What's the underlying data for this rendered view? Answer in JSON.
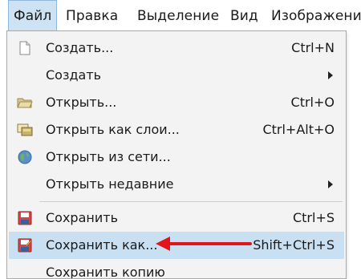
{
  "menubar": {
    "items": [
      {
        "label": "Файл"
      },
      {
        "label": "Правка"
      },
      {
        "label": "Выделение"
      },
      {
        "label": "Вид"
      },
      {
        "label": "Изображени"
      }
    ]
  },
  "file_menu": {
    "items": [
      {
        "label": "Создать...",
        "shortcut": "Ctrl+N",
        "icon": "new-document-icon"
      },
      {
        "label": "Создать",
        "shortcut": "",
        "icon": "",
        "submenu": true
      },
      {
        "label": "Открыть...",
        "shortcut": "Ctrl+O",
        "icon": "open-folder-icon"
      },
      {
        "label": "Открыть как слои...",
        "shortcut": "Ctrl+Alt+O",
        "icon": "open-as-layers-icon"
      },
      {
        "label": "Открыть из сети...",
        "shortcut": "",
        "icon": "globe-icon"
      },
      {
        "label": "Открыть недавние",
        "shortcut": "",
        "icon": "",
        "submenu": true
      },
      {
        "label": "Сохранить",
        "shortcut": "Ctrl+S",
        "icon": "save-icon"
      },
      {
        "label": "Сохранить как...",
        "shortcut": "Shift+Ctrl+S",
        "icon": "save-as-icon",
        "highlighted": true
      },
      {
        "label": "Сохранить копию",
        "shortcut": "",
        "icon": ""
      }
    ]
  },
  "colors": {
    "highlight": "#c9e0f2",
    "annotation_arrow": "#e0161c",
    "menu_bg": "#f3f3f3"
  }
}
